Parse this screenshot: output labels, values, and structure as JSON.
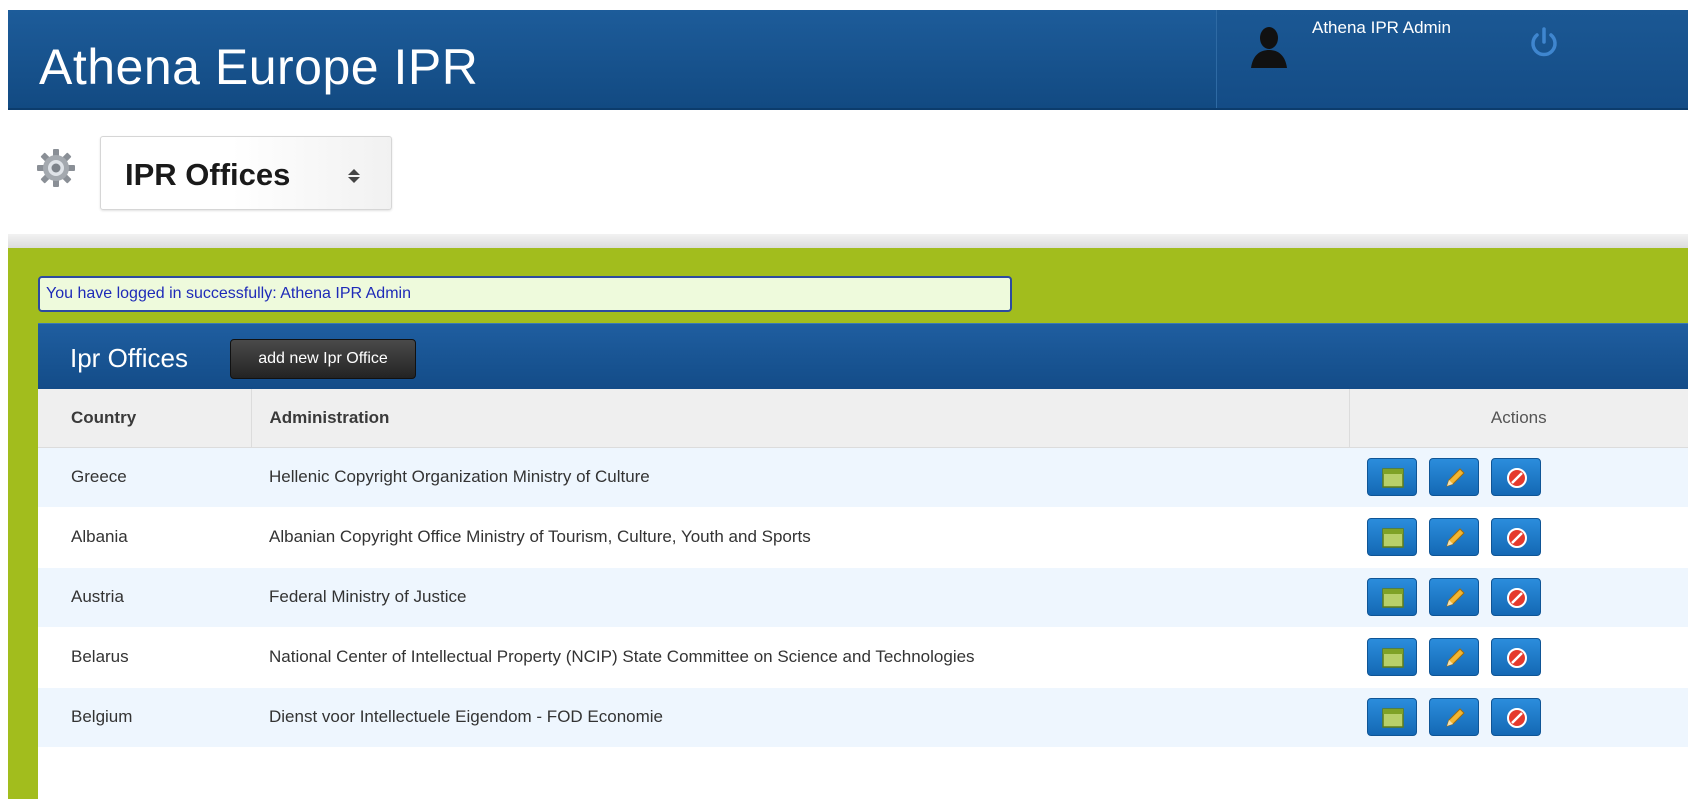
{
  "header": {
    "brand": "Athena Europe IPR",
    "user_name": "Athena IPR Admin"
  },
  "module": {
    "selected": "IPR Offices"
  },
  "alert": {
    "message": "You have logged in successfully: Athena IPR Admin"
  },
  "panel": {
    "title": "Ipr Offices",
    "add_button": "add new Ipr Office",
    "columns": {
      "country": "Country",
      "administration": "Administration",
      "actions": "Actions"
    },
    "rows": [
      {
        "country": "Greece",
        "administration": "Hellenic Copyright Organization Ministry of Culture"
      },
      {
        "country": "Albania",
        "administration": "Albanian Copyright Office Ministry of Tourism, Culture, Youth and Sports"
      },
      {
        "country": "Austria",
        "administration": "Federal Ministry of Justice"
      },
      {
        "country": "Belarus",
        "administration": "National Center of Intellectual Property (NCIP) State Committee on Science and Technologies"
      },
      {
        "country": "Belgium",
        "administration": "Dienst voor Intellectuele Eigendom - FOD Economie"
      }
    ]
  },
  "icons": {
    "view": "view-icon",
    "edit": "pencil-icon",
    "delete": "delete-icon"
  },
  "colors": {
    "header_blue": "#1d5c9a",
    "content_green": "#a2bd1d",
    "action_blue": "#1f7acb",
    "delete_red": "#e53a2c"
  }
}
